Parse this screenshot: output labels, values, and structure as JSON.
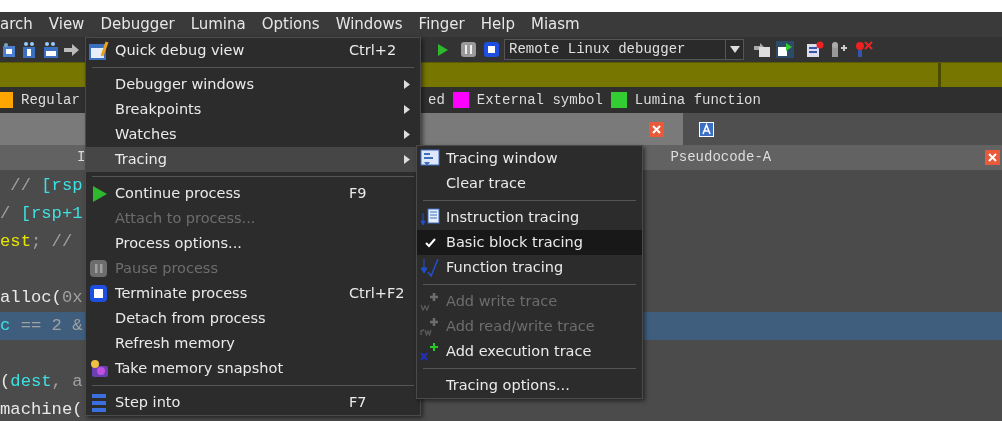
{
  "menubar": [
    {
      "label": "arch"
    },
    {
      "label": "View"
    },
    {
      "label": "Debugger"
    },
    {
      "label": "Lumina"
    },
    {
      "label": "Options"
    },
    {
      "label": "Windows"
    },
    {
      "label": "Finger"
    },
    {
      "label": "Help"
    },
    {
      "label": "Miasm"
    }
  ],
  "toolbar": {
    "debugger_select": "Remote Linux debugger"
  },
  "legend": [
    {
      "label": "Regular",
      "color": "#ffa500"
    },
    {
      "label": "ed"
    },
    {
      "label": "External symbol",
      "color": "#ff00ff"
    },
    {
      "label": "Lumina function",
      "color": "#33cc33"
    }
  ],
  "tabs": [
    {
      "label": "I"
    },
    {
      "label": "Pseudocode-A"
    }
  ],
  "code_lines": [
    {
      "kind": "code",
      "highlighted": false,
      "tokens": [
        {
          "text": " // ",
          "kind": "comment"
        },
        {
          "text": "[rsp",
          "kind": "var"
        }
      ]
    },
    {
      "kind": "code",
      "highlighted": false,
      "tokens": [
        {
          "text": "/ ",
          "kind": "comment"
        },
        {
          "text": "[rsp+1",
          "kind": "var"
        }
      ]
    },
    {
      "kind": "code",
      "highlighted": false,
      "tokens": [
        {
          "text": "est",
          "kind": "global"
        },
        {
          "text": "; //",
          "kind": "comment"
        }
      ]
    },
    {
      "kind": "blank"
    },
    {
      "kind": "code",
      "highlighted": false,
      "tokens": [
        {
          "text": "alloc(",
          "kind": "plain"
        },
        {
          "text": "0x",
          "kind": "comment"
        }
      ]
    },
    {
      "kind": "code",
      "highlighted": true,
      "tokens": [
        {
          "text": "c",
          "kind": "var"
        },
        {
          "text": " == 2 &",
          "kind": "comment"
        }
      ]
    },
    {
      "kind": "blank"
    },
    {
      "kind": "code",
      "highlighted": false,
      "tokens": [
        {
          "text": "(",
          "kind": "plain"
        },
        {
          "text": "dest",
          "kind": "var"
        },
        {
          "text": ", a",
          "kind": "comment"
        }
      ]
    },
    {
      "kind": "code",
      "highlighted": false,
      "tokens": [
        {
          "text": "machine(",
          "kind": "plain"
        }
      ]
    }
  ],
  "debugger_menu": [
    {
      "kind": "item",
      "label": "Quick debug view",
      "shortcut": "Ctrl+2",
      "disabled": false,
      "selected": false
    },
    {
      "kind": "separator"
    },
    {
      "kind": "submenu",
      "label": "Debugger windows",
      "disabled": false,
      "selected": false
    },
    {
      "kind": "submenu",
      "label": "Breakpoints",
      "disabled": false,
      "selected": false
    },
    {
      "kind": "submenu",
      "label": "Watches",
      "disabled": false,
      "selected": false
    },
    {
      "kind": "submenu",
      "label": "Tracing",
      "disabled": false,
      "selected": true
    },
    {
      "kind": "separator"
    },
    {
      "kind": "item",
      "label": "Continue process",
      "shortcut": "F9",
      "disabled": false,
      "selected": false
    },
    {
      "kind": "item",
      "label": "Attach to process...",
      "disabled": true,
      "selected": false
    },
    {
      "kind": "item",
      "label": "Process options...",
      "disabled": false,
      "selected": false
    },
    {
      "kind": "item",
      "label": "Pause process",
      "disabled": true,
      "selected": false
    },
    {
      "kind": "item",
      "label": "Terminate process",
      "shortcut": "Ctrl+F2",
      "disabled": false,
      "selected": false
    },
    {
      "kind": "item",
      "label": "Detach from process",
      "disabled": false,
      "selected": false
    },
    {
      "kind": "item",
      "label": "Refresh memory",
      "disabled": false,
      "selected": false
    },
    {
      "kind": "item",
      "label": "Take memory snapshot",
      "disabled": false,
      "selected": false
    },
    {
      "kind": "separator"
    },
    {
      "kind": "item",
      "label": "Step into",
      "shortcut": "F7",
      "disabled": false,
      "selected": false
    }
  ],
  "tracing_submenu": [
    {
      "kind": "item",
      "label": "Tracing window",
      "disabled": false,
      "checked": false,
      "selected": false
    },
    {
      "kind": "item",
      "label": "Clear trace",
      "disabled": false,
      "checked": false,
      "selected": false
    },
    {
      "kind": "separator"
    },
    {
      "kind": "item",
      "label": "Instruction tracing",
      "disabled": false,
      "checked": false,
      "selected": false
    },
    {
      "kind": "item",
      "label": "Basic block tracing",
      "disabled": false,
      "checked": true,
      "selected": true
    },
    {
      "kind": "item",
      "label": "Function tracing",
      "disabled": false,
      "checked": false,
      "selected": false
    },
    {
      "kind": "separator"
    },
    {
      "kind": "item",
      "label": "Add write trace",
      "disabled": true,
      "checked": false,
      "selected": false
    },
    {
      "kind": "item",
      "label": "Add read/write trace",
      "disabled": true,
      "checked": false,
      "selected": false
    },
    {
      "kind": "item",
      "label": "Add execution trace",
      "disabled": false,
      "checked": false,
      "selected": false
    },
    {
      "kind": "separator"
    },
    {
      "kind": "item",
      "label": "Tracing options...",
      "disabled": false,
      "checked": false,
      "selected": false
    }
  ]
}
